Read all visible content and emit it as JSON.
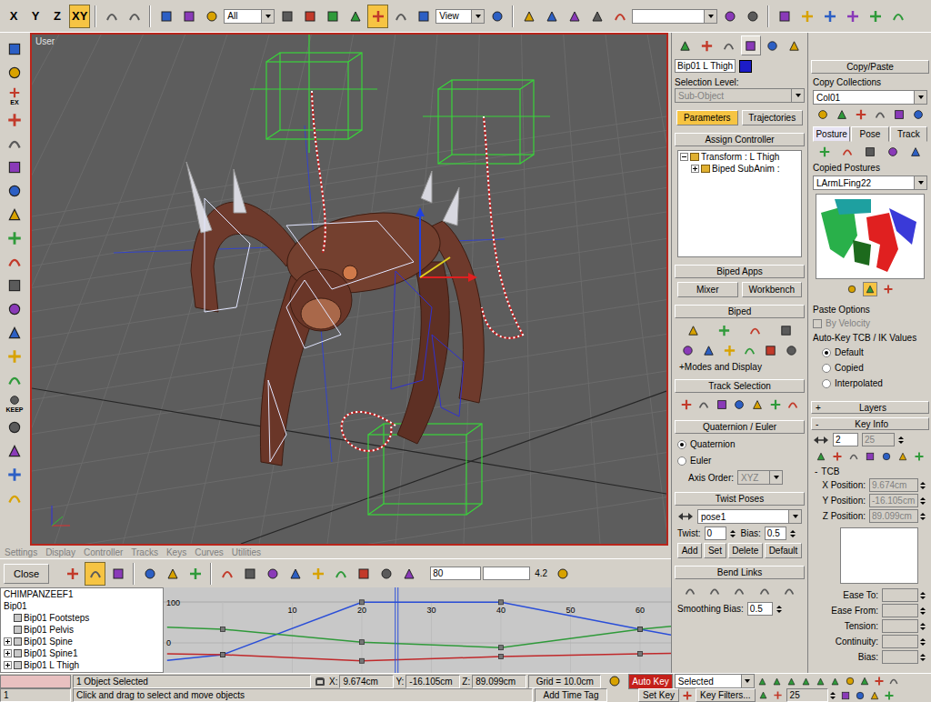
{
  "main_toolbar": {
    "axis_buttons": [
      {
        "label": "X",
        "selected": false
      },
      {
        "label": "Y",
        "selected": false
      },
      {
        "label": "Z",
        "selected": false
      },
      {
        "label": "XY",
        "selected": true
      }
    ],
    "selection_filter": "All",
    "transform_tools": [
      {
        "selected": false
      },
      {
        "selected": true
      },
      {
        "selected": false
      },
      {
        "selected": false
      }
    ],
    "reference_coord": "View"
  },
  "left_toolbar": [
    {
      "kind": "icon"
    },
    {
      "kind": "icon"
    },
    {
      "kind": "labeled",
      "label": "EX"
    },
    {
      "kind": "icon"
    },
    {
      "kind": "icon"
    },
    {
      "kind": "icon"
    },
    {
      "kind": "icon"
    },
    {
      "kind": "icon"
    },
    {
      "kind": "icon"
    },
    {
      "kind": "icon"
    },
    {
      "kind": "icon"
    },
    {
      "kind": "icon"
    },
    {
      "kind": "icon"
    },
    {
      "kind": "icon"
    },
    {
      "kind": "icon"
    },
    {
      "kind": "labeled",
      "label": "KEEP"
    },
    {
      "kind": "icon"
    },
    {
      "kind": "icon"
    },
    {
      "kind": "icon"
    },
    {
      "kind": "icon"
    }
  ],
  "viewport": {
    "label": "User"
  },
  "command_panel": {
    "tabs": [
      {
        "selected": false
      },
      {
        "selected": false
      },
      {
        "selected": false
      },
      {
        "selected": true
      },
      {
        "selected": false
      },
      {
        "selected": false
      }
    ],
    "object_name": "Bip01 L Thigh",
    "object_color": "#1c1cc8",
    "selection_level": {
      "label": "Selection Level:",
      "value": "Sub-Object",
      "disabled": true
    },
    "mode_buttons": [
      {
        "label": "Parameters",
        "selected": true
      },
      {
        "label": "Trajectories",
        "selected": false
      }
    ],
    "assign_controller": {
      "title": "Assign Controller",
      "tree": [
        {
          "label": "Transform : L Thigh",
          "depth": 0,
          "expanded": true
        },
        {
          "label": "Biped SubAnim :",
          "depth": 1,
          "expanded": false
        }
      ]
    },
    "biped_apps": {
      "title": "Biped Apps",
      "buttons": [
        "Mixer",
        "Workbench"
      ]
    },
    "biped": {
      "title": "Biped",
      "modes_link": "+Modes and Display"
    },
    "track_selection": {
      "title": "Track Selection"
    },
    "quaternion_euler": {
      "title": "Quaternion / Euler",
      "options": [
        {
          "label": "Quaternion",
          "selected": true
        },
        {
          "label": "Euler",
          "selected": false
        }
      ],
      "axis_order_label": "Axis Order:",
      "axis_order": "XYZ",
      "axis_order_disabled": true
    },
    "twist_poses": {
      "title": "Twist Poses",
      "pose": "pose1",
      "twist_label": "Twist:",
      "twist": "0",
      "bias_label": "Bias:",
      "bias": "0.5",
      "buttons": [
        "Add",
        "Set",
        "Delete",
        "Default"
      ]
    },
    "bend_links": {
      "title": "Bend Links",
      "smoothing_label": "Smoothing Bias:",
      "smoothing": "0.5"
    }
  },
  "copy_paste": {
    "title": "Copy/Paste",
    "collections_label": "Copy Collections",
    "collection": "Col01",
    "tabs": [
      {
        "label": "Posture",
        "selected": true
      },
      {
        "label": "Pose",
        "selected": false
      },
      {
        "label": "Track",
        "selected": false
      }
    ],
    "copied_label": "Copied Postures",
    "copied": "LArmLFing22",
    "paste_options": {
      "title": "Paste Options",
      "by_velocity": {
        "label": "By Velocity",
        "checked": false,
        "disabled": true
      },
      "autokey_label": "Auto-Key TCB / IK Values",
      "options": [
        {
          "label": "Default",
          "selected": true
        },
        {
          "label": "Copied",
          "selected": false
        },
        {
          "label": "Interpolated",
          "selected": false
        }
      ]
    }
  },
  "layers": {
    "sign": "+",
    "title": "Layers",
    "expanded": false
  },
  "key_info": {
    "sign": "-",
    "title": "Key Info",
    "key_number": "2",
    "key_time": "25",
    "key_time_disabled": true,
    "tcb": {
      "sign": "-",
      "title": "TCB"
    },
    "positions": [
      {
        "label": "X Position:",
        "value": "9.674cm",
        "disabled": true
      },
      {
        "label": "Y Position:",
        "value": "-16.105cm",
        "disabled": true
      },
      {
        "label": "Z Position:",
        "value": "89.099cm",
        "disabled": true
      }
    ],
    "params": [
      "Ease To:",
      "Ease From:",
      "Tension:",
      "Continuity:",
      "Bias:"
    ]
  },
  "curve_editor": {
    "menus": [
      {
        "label": "Settings",
        "disabled": true
      },
      {
        "label": "Display",
        "disabled": true
      },
      {
        "label": "Controller",
        "disabled": true
      },
      {
        "label": "Tracks",
        "disabled": true
      },
      {
        "label": "Keys",
        "disabled": true
      },
      {
        "label": "Curves",
        "disabled": true
      },
      {
        "label": "Utilities",
        "disabled": true
      }
    ],
    "close": "Close",
    "tools": [
      {
        "selected": false
      },
      {
        "selected": true
      },
      {
        "selected": false
      },
      {
        "selected": false
      },
      {
        "selected": false
      },
      {
        "selected": false
      },
      {
        "selected": false
      },
      {
        "selected": false
      },
      {
        "selected": false
      },
      {
        "selected": false
      },
      {
        "selected": false
      },
      {
        "selected": false
      },
      {
        "selected": false
      },
      {
        "selected": false
      },
      {
        "selected": false
      }
    ],
    "zoom_field": "80",
    "zoom_value": "4.2",
    "tree": [
      {
        "label": "CHIMPANZEEF1",
        "kind": "text",
        "expanded": false
      },
      {
        "label": "Bip01",
        "kind": "text",
        "expanded": false
      },
      {
        "label": "Bip01 Footsteps",
        "kind": "node",
        "expanded": false
      },
      {
        "label": "Bip01 Pelvis",
        "kind": "node",
        "expanded": false
      },
      {
        "label": "Bip01 Spine",
        "kind": "branch",
        "expanded": false
      },
      {
        "label": "Bip01 Spine1",
        "kind": "branch",
        "expanded": false
      },
      {
        "label": "Bip01 L Thigh",
        "kind": "branch",
        "expanded": false
      }
    ],
    "graph": {
      "top_label": "100",
      "zero_label": "0",
      "frame_labels": [
        "10",
        "20",
        "30",
        "40",
        "50",
        "60"
      ],
      "current_frame": 25,
      "frames": [
        -8,
        0,
        20,
        40,
        60,
        66
      ],
      "series": [
        {
          "color": "#2a4ed8",
          "values": [
            -45,
            -30,
            104,
            104,
            35,
            15
          ]
        },
        {
          "color": "#2f9a3a",
          "values": [
            40,
            35,
            2,
            -12,
            35,
            45
          ]
        },
        {
          "color": "#c0282a",
          "values": [
            -28,
            -30,
            -46,
            -35,
            -28,
            -26
          ]
        }
      ]
    }
  },
  "status_bar": {
    "frame_field": "1",
    "selection": "1 Object Selected",
    "prompt": "Click and drag to select and move objects",
    "coords": [
      {
        "axis": "X:",
        "value": "9.674cm"
      },
      {
        "axis": "Y:",
        "value": "-16.105cm"
      },
      {
        "axis": "Z:",
        "value": "89.099cm"
      }
    ],
    "grid": "Grid = 10.0cm",
    "add_time_tag": "Add Time Tag",
    "auto_key": {
      "label": "Auto Key",
      "on": true
    },
    "set_key": "Set Key",
    "key_mode": "Selected",
    "key_filters": "Key Filters...",
    "current_frame": "25"
  }
}
